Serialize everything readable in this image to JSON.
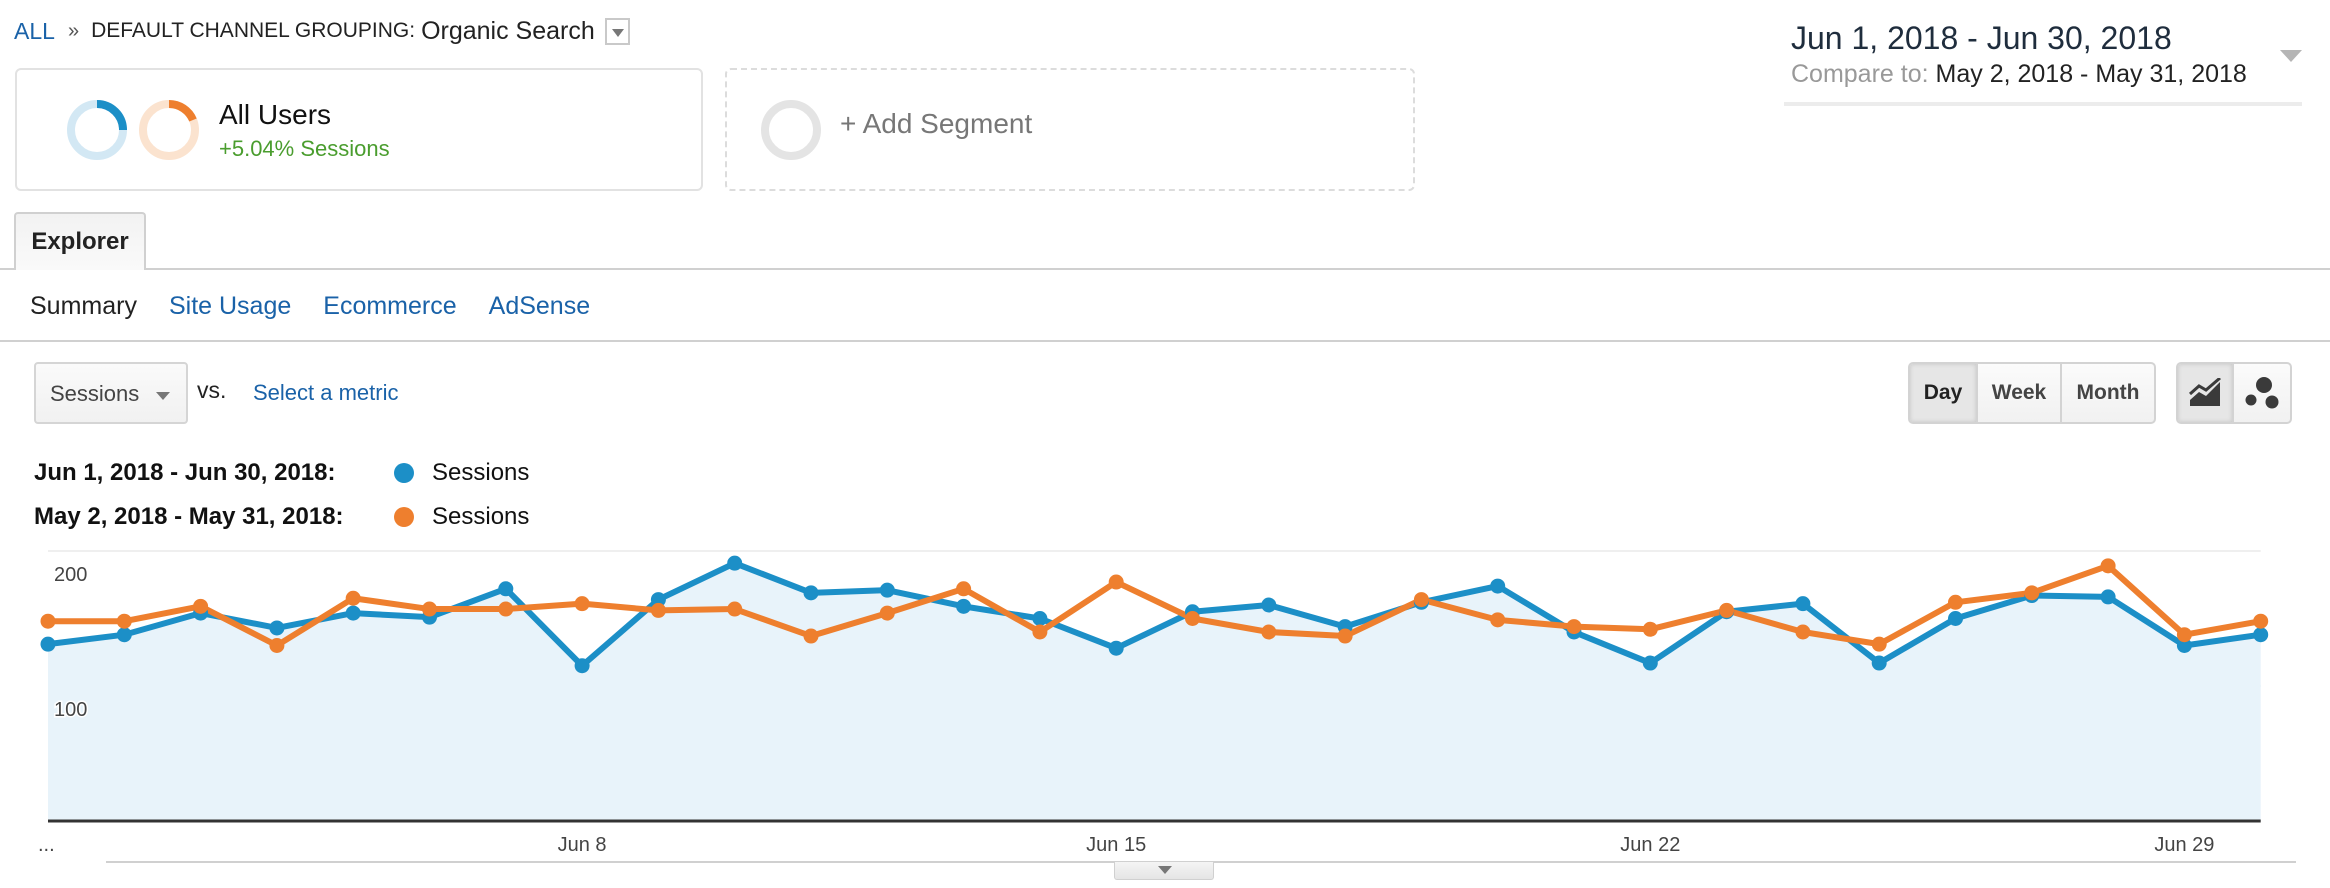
{
  "breadcrumb": {
    "root": "ALL",
    "separator": "»",
    "dimension": "DEFAULT CHANNEL GROUPING:",
    "value": "Organic Search"
  },
  "segments": {
    "active": {
      "name": "All Users",
      "delta": "+5.04% Sessions",
      "delta_color": "#4a9d2e"
    },
    "add_label": "+ Add Segment"
  },
  "date_range": {
    "main": "Jun 1, 2018 - Jun 30, 2018",
    "compare_label": "Compare to:",
    "compare_value": "May 2, 2018 - May 31, 2018"
  },
  "tabs": {
    "explorer": "Explorer",
    "subtabs": [
      {
        "label": "Summary",
        "active": true
      },
      {
        "label": "Site Usage",
        "active": false
      },
      {
        "label": "Ecommerce",
        "active": false
      },
      {
        "label": "AdSense",
        "active": false
      }
    ]
  },
  "metric_controls": {
    "primary_metric": "Sessions",
    "vs_label": "vs.",
    "secondary_placeholder": "Select a metric"
  },
  "period_buttons": [
    {
      "label": "Day",
      "active": true
    },
    {
      "label": "Week",
      "active": false
    },
    {
      "label": "Month",
      "active": false
    }
  ],
  "chart_type_buttons": [
    {
      "icon": "line-chart-icon",
      "active": true
    },
    {
      "icon": "motion-chart-icon",
      "active": false
    }
  ],
  "legend": [
    {
      "range": "Jun 1, 2018 - Jun 30, 2018:",
      "metric": "Sessions",
      "color": "#1c8fc7"
    },
    {
      "range": "May 2, 2018 - May 31, 2018:",
      "metric": "Sessions",
      "color": "#ee7f2e"
    }
  ],
  "colors": {
    "link": "#1a62a8",
    "primary_series": "#1c8fc7",
    "compare_series": "#ee7f2e",
    "area_fill": "#e8f3fa"
  },
  "chart_data": {
    "type": "line",
    "title": "",
    "xlabel": "",
    "ylabel": "Sessions",
    "ylim": [
      0,
      200
    ],
    "yticks": [
      100,
      200
    ],
    "grid": true,
    "x": [
      "Jun 1",
      "Jun 2",
      "Jun 3",
      "Jun 4",
      "Jun 5",
      "Jun 6",
      "Jun 7",
      "Jun 8",
      "Jun 9",
      "Jun 10",
      "Jun 11",
      "Jun 12",
      "Jun 13",
      "Jun 14",
      "Jun 15",
      "Jun 16",
      "Jun 17",
      "Jun 18",
      "Jun 19",
      "Jun 20",
      "Jun 21",
      "Jun 22",
      "Jun 23",
      "Jun 24",
      "Jun 25",
      "Jun 26",
      "Jun 27",
      "Jun 28",
      "Jun 29",
      "Jun 30"
    ],
    "xtick_labels": [
      {
        "index": 0,
        "label": "..."
      },
      {
        "index": 7,
        "label": "Jun 8"
      },
      {
        "index": 14,
        "label": "Jun 15"
      },
      {
        "index": 21,
        "label": "Jun 22"
      },
      {
        "index": 28,
        "label": "Jun 29"
      }
    ],
    "series": [
      {
        "name": "Sessions (Jun 1, 2018 - Jun 30, 2018)",
        "color": "#1c8fc7",
        "area": true,
        "values": [
          131,
          138,
          154,
          143,
          154,
          151,
          172,
          115,
          164,
          191,
          169,
          171,
          159,
          150,
          128,
          155,
          160,
          144,
          162,
          174,
          140,
          117,
          155,
          161,
          117,
          150,
          167,
          166,
          130,
          138
        ]
      },
      {
        "name": "Sessions (May 2, 2018 - May 31, 2018)",
        "color": "#ee7f2e",
        "area": false,
        "values": [
          148,
          148,
          159,
          130,
          165,
          157,
          157,
          161,
          156,
          157,
          137,
          154,
          172,
          140,
          177,
          150,
          140,
          137,
          164,
          149,
          144,
          142,
          156,
          140,
          131,
          162,
          169,
          189,
          138,
          148
        ]
      }
    ]
  }
}
